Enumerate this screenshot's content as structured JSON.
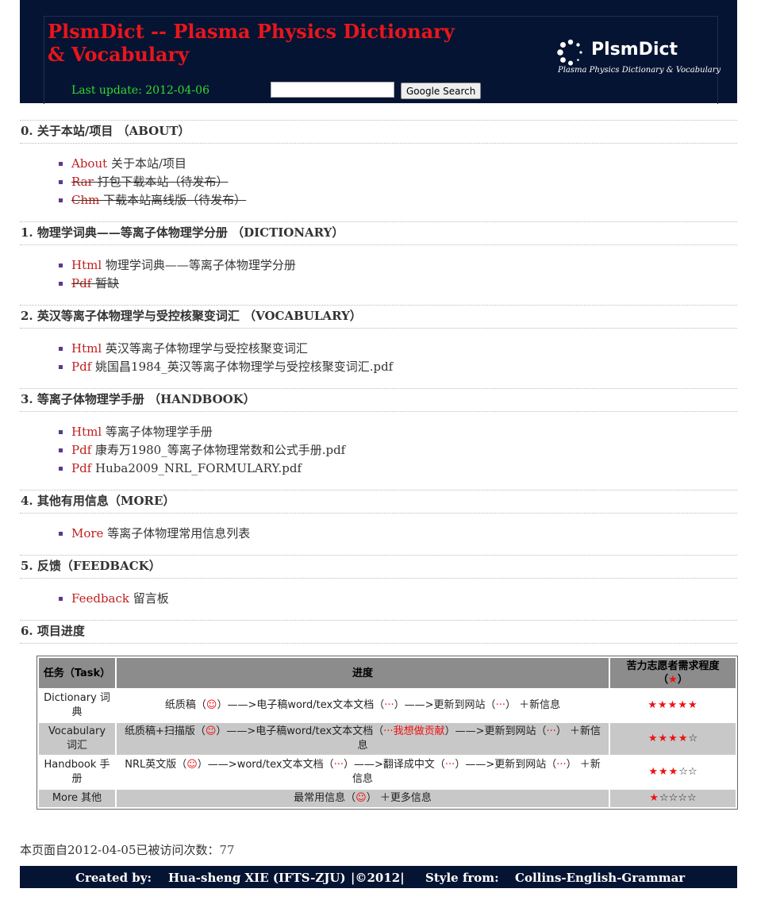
{
  "header": {
    "title": "PlsmDict -- Plasma Physics Dictionary & Vocabulary",
    "last_update": "Last update: 2012-04-06",
    "search_button": "Google Search",
    "logo_name": "PlsmDict",
    "logo_tagline": "Plasma Physics Dictionary & Vocabulary"
  },
  "sections": [
    {
      "heading": "0. 关于本站/项目 （ABOUT）",
      "items": [
        {
          "link": "About",
          "text": "关于本站/项目"
        },
        {
          "link": "Rar",
          "text": "打包下载本站（待发布）"
        },
        {
          "link": "Chm",
          "text": "下载本站离线版（待发布）"
        }
      ]
    },
    {
      "heading": "1. 物理学词典——等离子体物理学分册 （DICTIONARY）",
      "items": [
        {
          "link": "Html",
          "text": "物理学词典——等离子体物理学分册"
        },
        {
          "link": "Pdf",
          "text": "暂缺"
        }
      ]
    },
    {
      "heading": "2. 英汉等离子体物理学与受控核聚变词汇 （VOCABULARY）",
      "items": [
        {
          "link": "Html",
          "text": "英汉等离子体物理学与受控核聚变词汇"
        },
        {
          "link": "Pdf",
          "text": "姚国昌1984_英汉等离子体物理学与受控核聚变词汇.pdf"
        }
      ]
    },
    {
      "heading": "3. 等离子体物理学手册 （HANDBOOK）",
      "items": [
        {
          "link": "Html",
          "text": "等离子体物理学手册"
        },
        {
          "link": "Pdf",
          "text": "康寿万1980_等离子体物理常数和公式手册.pdf"
        },
        {
          "link": "Pdf",
          "text": "Huba2009_NRL_FORMULARY.pdf"
        }
      ]
    },
    {
      "heading": "4. 其他有用信息（MORE）",
      "items": [
        {
          "link": "More",
          "text": "等离子体物理常用信息列表"
        }
      ]
    },
    {
      "heading": "5. 反馈（FEEDBACK）",
      "items": [
        {
          "link": "Feedback",
          "text": "留言板"
        }
      ]
    },
    {
      "heading": "6. 项目进度"
    }
  ],
  "table": {
    "headers": [
      "任务（Task）",
      "进度",
      "苦力志愿者需求程度（",
      "★",
      "）"
    ],
    "rows": [
      {
        "task": "Dictionary 词典",
        "p1": "纸质稿（",
        "s1": "☺",
        "p2": "）——>电子稿word/tex文本文档（",
        "s2": "···",
        "p3": "）——>更新到网站（",
        "s3": "···",
        "p4": "） ＋新信息",
        "p5": "",
        "stars_filled": "★★★★★",
        "stars_empty": ""
      },
      {
        "task": "Vocabulary 词汇",
        "p1": "纸质稿+扫描版（",
        "s1": "☺",
        "p2": "）——>电子稿word/tex文本文档（",
        "s2": "···我想做贡献",
        "p3": "）——>更新到网站（",
        "s3": "···",
        "p4": "） ＋新信息",
        "p5": "",
        "stars_filled": "★★★★",
        "stars_empty": "☆"
      },
      {
        "task": "Handbook 手册",
        "p1": "NRL英文版（",
        "s1": "☺",
        "p2": "）——>word/tex文本文档（",
        "s2": "···",
        "p3": "）——>翻译成中文（",
        "s3": "···",
        "p4": "）——>更新到网站（",
        "s4": "···",
        "p5": "） ＋新信息",
        "stars_filled": "★★★",
        "stars_empty": "☆☆"
      },
      {
        "task": "More 其他",
        "p1": "最常用信息（",
        "s1": "☺",
        "p2": "） ＋更多信息",
        "s2": "",
        "p3": "",
        "s3": "",
        "p4": "",
        "p5": "",
        "stars_filled": "★",
        "stars_empty": "☆☆☆☆"
      }
    ]
  },
  "visits": {
    "label": "本页面自2012-04-05已被访问次数：",
    "count": "77"
  },
  "footer": {
    "created_by": "Created by:",
    "author": "Hua-sheng XIE (IFTS-ZJU)",
    "copyright": "|©2012|",
    "style_from": "Style from:",
    "style_name": "Collins-English-Grammar"
  },
  "colors": {
    "header_bg": "#061433",
    "title_red": "#e8161b",
    "update_green": "#2edc2e",
    "link_red": "#c02020"
  }
}
